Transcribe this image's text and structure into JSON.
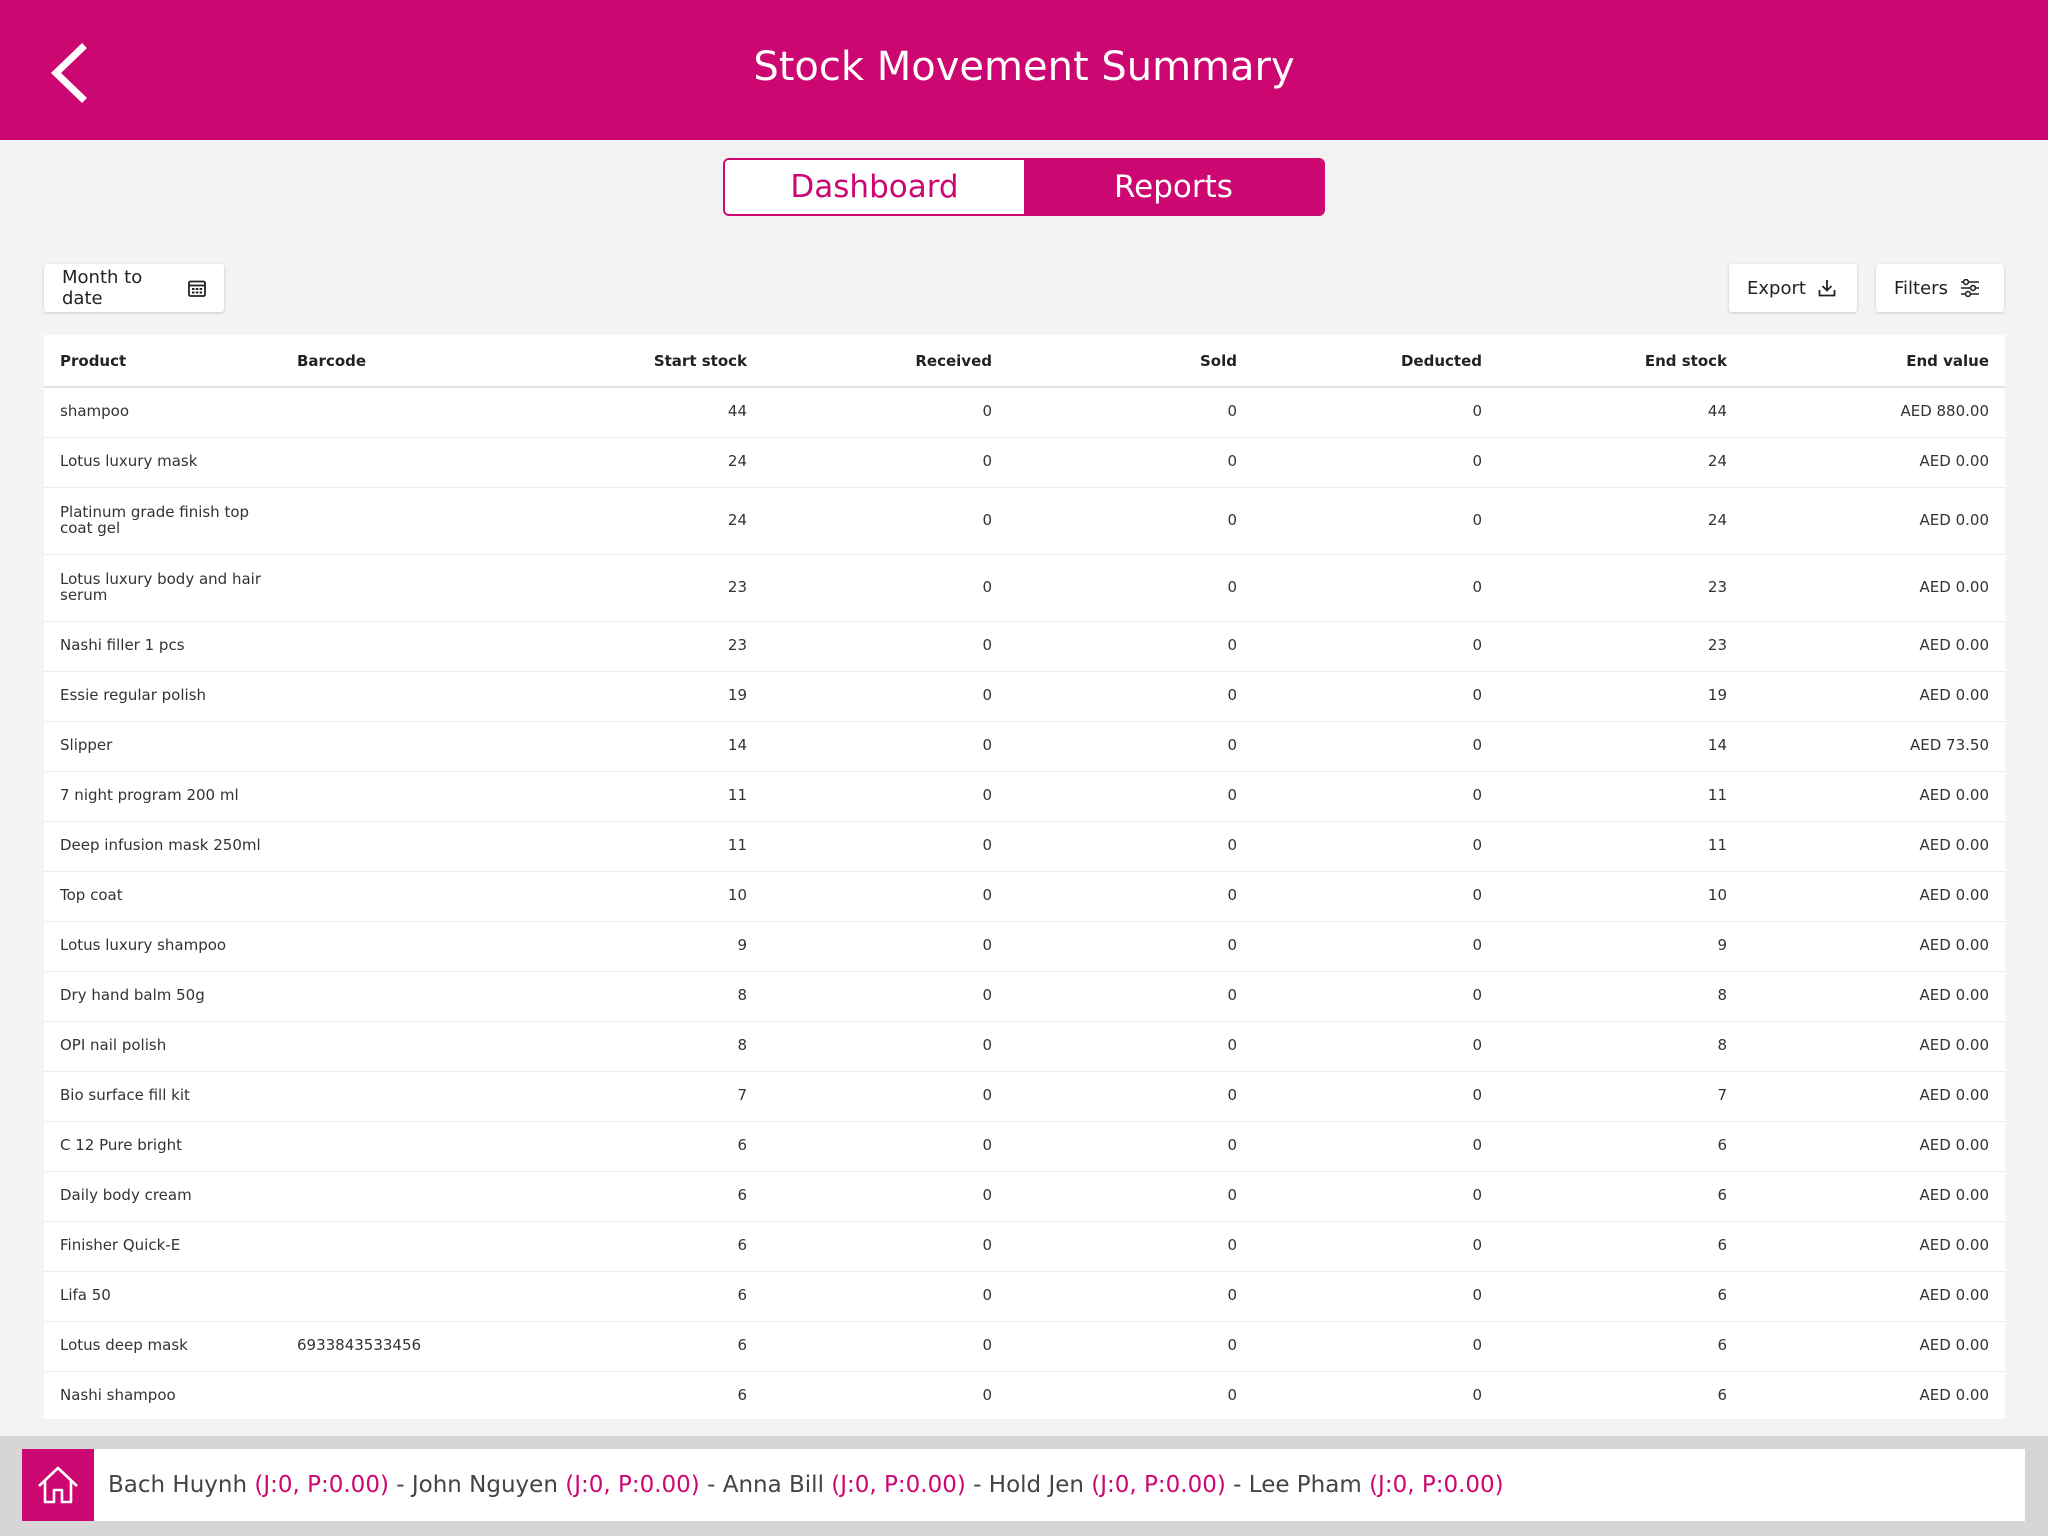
{
  "header": {
    "title": "Stock Movement Summary"
  },
  "tabs": [
    {
      "label": "Dashboard",
      "active": false
    },
    {
      "label": "Reports",
      "active": true
    }
  ],
  "toolbar": {
    "date_range": "Month to date",
    "export_label": "Export",
    "filters_label": "Filters"
  },
  "table": {
    "columns": [
      "Product",
      "Barcode",
      "Start stock",
      "Received",
      "Sold",
      "Deducted",
      "End stock",
      "End value"
    ],
    "rows": [
      [
        "shampoo",
        "",
        "44",
        "0",
        "0",
        "0",
        "44",
        "AED 880.00"
      ],
      [
        "Lotus luxury mask",
        "",
        "24",
        "0",
        "0",
        "0",
        "24",
        "AED 0.00"
      ],
      [
        "Platinum grade finish top coat gel",
        "",
        "24",
        "0",
        "0",
        "0",
        "24",
        "AED 0.00"
      ],
      [
        "Lotus luxury body and hair serum",
        "",
        "23",
        "0",
        "0",
        "0",
        "23",
        "AED 0.00"
      ],
      [
        "Nashi filler 1 pcs",
        "",
        "23",
        "0",
        "0",
        "0",
        "23",
        "AED 0.00"
      ],
      [
        "Essie regular polish",
        "",
        "19",
        "0",
        "0",
        "0",
        "19",
        "AED 0.00"
      ],
      [
        "Slipper",
        "",
        "14",
        "0",
        "0",
        "0",
        "14",
        "AED 73.50"
      ],
      [
        "7 night program 200 ml",
        "",
        "11",
        "0",
        "0",
        "0",
        "11",
        "AED 0.00"
      ],
      [
        "Deep infusion mask 250ml",
        "",
        "11",
        "0",
        "0",
        "0",
        "11",
        "AED 0.00"
      ],
      [
        "Top coat",
        "",
        "10",
        "0",
        "0",
        "0",
        "10",
        "AED 0.00"
      ],
      [
        "Lotus luxury shampoo",
        "",
        "9",
        "0",
        "0",
        "0",
        "9",
        "AED 0.00"
      ],
      [
        "Dry hand balm 50g",
        "",
        "8",
        "0",
        "0",
        "0",
        "8",
        "AED 0.00"
      ],
      [
        "OPI nail polish",
        "",
        "8",
        "0",
        "0",
        "0",
        "8",
        "AED 0.00"
      ],
      [
        "Bio surface fill kit",
        "",
        "7",
        "0",
        "0",
        "0",
        "7",
        "AED 0.00"
      ],
      [
        "C 12 Pure bright",
        "",
        "6",
        "0",
        "0",
        "0",
        "6",
        "AED 0.00"
      ],
      [
        "Daily body cream",
        "",
        "6",
        "0",
        "0",
        "0",
        "6",
        "AED 0.00"
      ],
      [
        "Finisher Quick-E",
        "",
        "6",
        "0",
        "0",
        "0",
        "6",
        "AED 0.00"
      ],
      [
        "Lifa 50",
        "",
        "6",
        "0",
        "0",
        "0",
        "6",
        "AED 0.00"
      ],
      [
        "Lotus deep mask",
        "6933843533456",
        "6",
        "0",
        "0",
        "0",
        "6",
        "AED 0.00"
      ],
      [
        "Nashi shampoo",
        "",
        "6",
        "0",
        "0",
        "0",
        "6",
        "AED 0.00"
      ]
    ]
  },
  "footer": {
    "staff": [
      {
        "name": "Bach Huynh",
        "stats": "(J:0, P:0.00)"
      },
      {
        "name": "John Nguyen",
        "stats": "(J:0, P:0.00)"
      },
      {
        "name": "Anna Bill",
        "stats": "(J:0, P:0.00)"
      },
      {
        "name": "Hold Jen",
        "stats": "(J:0, P:0.00)"
      },
      {
        "name": "Lee Pham",
        "stats": "(J:0, P:0.00)"
      }
    ],
    "separator": " - "
  },
  "colors": {
    "brand": "#cc0772",
    "background": "#f2f2f2"
  },
  "icons": [
    "back-chevron-icon",
    "calendar-icon",
    "download-icon",
    "sliders-icon",
    "home-icon"
  ]
}
